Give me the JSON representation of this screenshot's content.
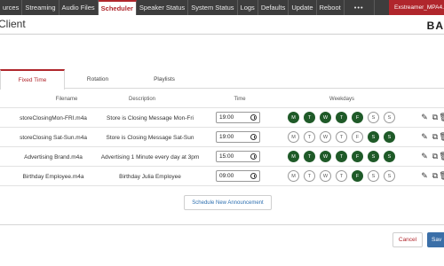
{
  "nav": {
    "items": [
      "urces",
      "Streaming",
      "Audio Files",
      "Scheduler",
      "Speaker Status",
      "System Status",
      "Logs",
      "Defaults",
      "Update",
      "Reboot"
    ],
    "active": "Scheduler",
    "more": "•••",
    "user": "Exstreamer_MPA4..."
  },
  "header": {
    "title": "Client",
    "logo": "BA"
  },
  "tabs": [
    "Fixed Time",
    "Rotation",
    "Playlists"
  ],
  "table": {
    "columns": {
      "filename": "Filename",
      "description": "Description",
      "time": "Time",
      "weekdays": "Weekdays"
    },
    "weekday_letters": [
      "M",
      "T",
      "W",
      "T",
      "F",
      "S",
      "S"
    ],
    "rows": [
      {
        "filename": "storeClosingMon-FRI.m4a",
        "description": "Store is Closing Message Mon-Fri",
        "time": "19:00",
        "days": [
          true,
          true,
          true,
          true,
          true,
          false,
          false
        ]
      },
      {
        "filename": "storeClosing Sat-Sun.m4a",
        "description": "Store is Closing Message Sat-Sun",
        "time": "19:00",
        "days": [
          false,
          false,
          false,
          false,
          false,
          true,
          true
        ]
      },
      {
        "filename": "Advertising Brand.m4a",
        "description": "Advertising 1 Minute every day at 3pm",
        "time": "15:00",
        "days": [
          true,
          true,
          true,
          true,
          true,
          true,
          true
        ]
      },
      {
        "filename": "Birthday Employee.m4a",
        "description": "Birthday Julia Employee",
        "time": "09:00",
        "days": [
          false,
          false,
          false,
          false,
          true,
          false,
          false
        ]
      }
    ],
    "actions": {
      "edit": "✎",
      "copy": "⧉",
      "delete": "🗑"
    }
  },
  "buttons": {
    "schedule": "Schedule New Announcement",
    "cancel": "Cancel",
    "save": "Sav"
  },
  "colors": {
    "accent": "#b0262c",
    "day_on": "#1f5a28",
    "link": "#2d6fb0",
    "save": "#3b6fa8"
  }
}
